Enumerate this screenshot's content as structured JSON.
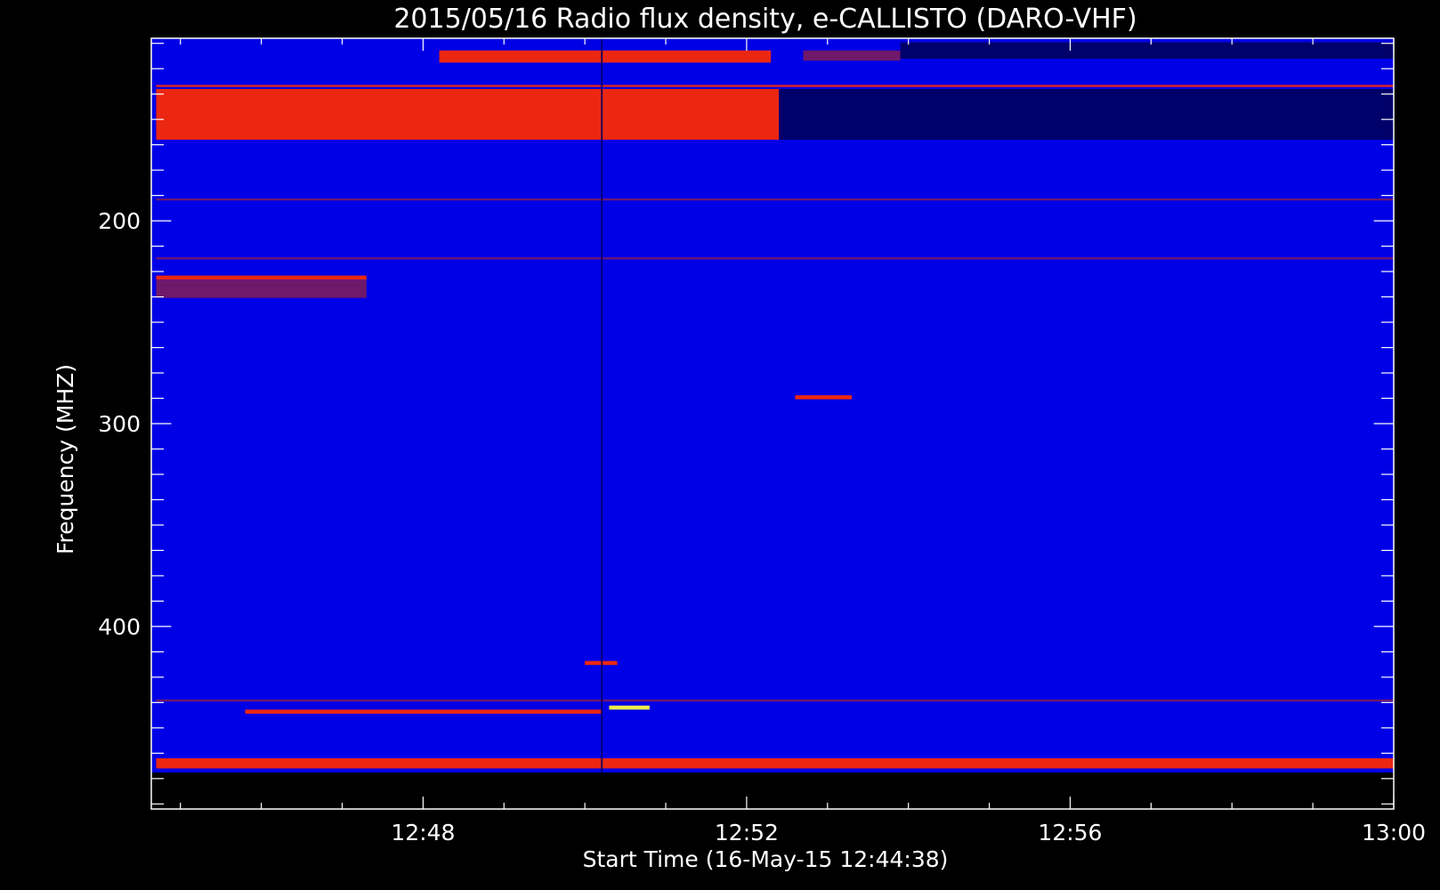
{
  "chart_data": {
    "type": "heatmap",
    "title": "2015/05/16  Radio flux density, e-CALLISTO (DARO-VHF)",
    "xlabel": "Start Time (16-May-15 12:44:38)",
    "ylabel": "Frequency (MHZ)",
    "x_ticks": [
      "12:48",
      "12:52",
      "12:56",
      "13:00"
    ],
    "x_tick_minutes": [
      48,
      52,
      56,
      60
    ],
    "x_range_minutes": [
      44.64,
      60
    ],
    "x_minor_step_minutes": 1,
    "y_ticks": [
      200,
      300,
      400
    ],
    "y_range_mhz": [
      110,
      490
    ],
    "data_freq_range_mhz": [
      110,
      472
    ],
    "y_minor_step_mhz": 12.5,
    "colors": {
      "background": "#0000e6",
      "low": "#000060",
      "mid": "#7a1a60",
      "high": "#ff2a00",
      "peak": "#ffff40"
    },
    "features": [
      {
        "kind": "band",
        "level": "high",
        "t": [
          44.7,
          52.4
        ],
        "f": [
          135,
          160
        ]
      },
      {
        "kind": "band",
        "level": "low",
        "t": [
          52.4,
          60
        ],
        "f": [
          135,
          160
        ]
      },
      {
        "kind": "band",
        "level": "high",
        "t": [
          48.2,
          52.3
        ],
        "f": [
          116,
          122
        ]
      },
      {
        "kind": "band",
        "level": "mid",
        "t": [
          52.7,
          53.9
        ],
        "f": [
          116,
          121
        ]
      },
      {
        "kind": "band",
        "level": "low",
        "t": [
          53.9,
          60
        ],
        "f": [
          112,
          120
        ]
      },
      {
        "kind": "line",
        "level": "high",
        "t": [
          44.7,
          60
        ],
        "f": [
          133,
          134
        ]
      },
      {
        "kind": "line",
        "level": "mid",
        "t": [
          44.7,
          60
        ],
        "f": [
          189,
          190
        ]
      },
      {
        "kind": "line",
        "level": "mid",
        "t": [
          44.7,
          60
        ],
        "f": [
          218,
          219
        ]
      },
      {
        "kind": "band",
        "level": "high",
        "t": [
          44.7,
          47.3
        ],
        "f": [
          227,
          229
        ]
      },
      {
        "kind": "band",
        "level": "mid",
        "t": [
          44.7,
          47.3
        ],
        "f": [
          229,
          238
        ]
      },
      {
        "kind": "band",
        "level": "high",
        "t": [
          52.6,
          53.3
        ],
        "f": [
          286,
          288
        ]
      },
      {
        "kind": "band",
        "level": "high",
        "t": [
          50.0,
          50.4
        ],
        "f": [
          417,
          419
        ]
      },
      {
        "kind": "band",
        "level": "peak",
        "t": [
          50.3,
          50.8
        ],
        "f": [
          439,
          441
        ]
      },
      {
        "kind": "band",
        "level": "high",
        "t": [
          45.8,
          50.2
        ],
        "f": [
          441,
          443
        ]
      },
      {
        "kind": "line",
        "level": "mid",
        "t": [
          44.7,
          60
        ],
        "f": [
          436,
          437
        ]
      },
      {
        "kind": "line",
        "level": "high",
        "t": [
          44.7,
          60
        ],
        "f": [
          465,
          470
        ]
      },
      {
        "kind": "line",
        "level": "low",
        "t": [
          50.2,
          50.22
        ],
        "f": [
          110,
          472
        ]
      }
    ]
  }
}
